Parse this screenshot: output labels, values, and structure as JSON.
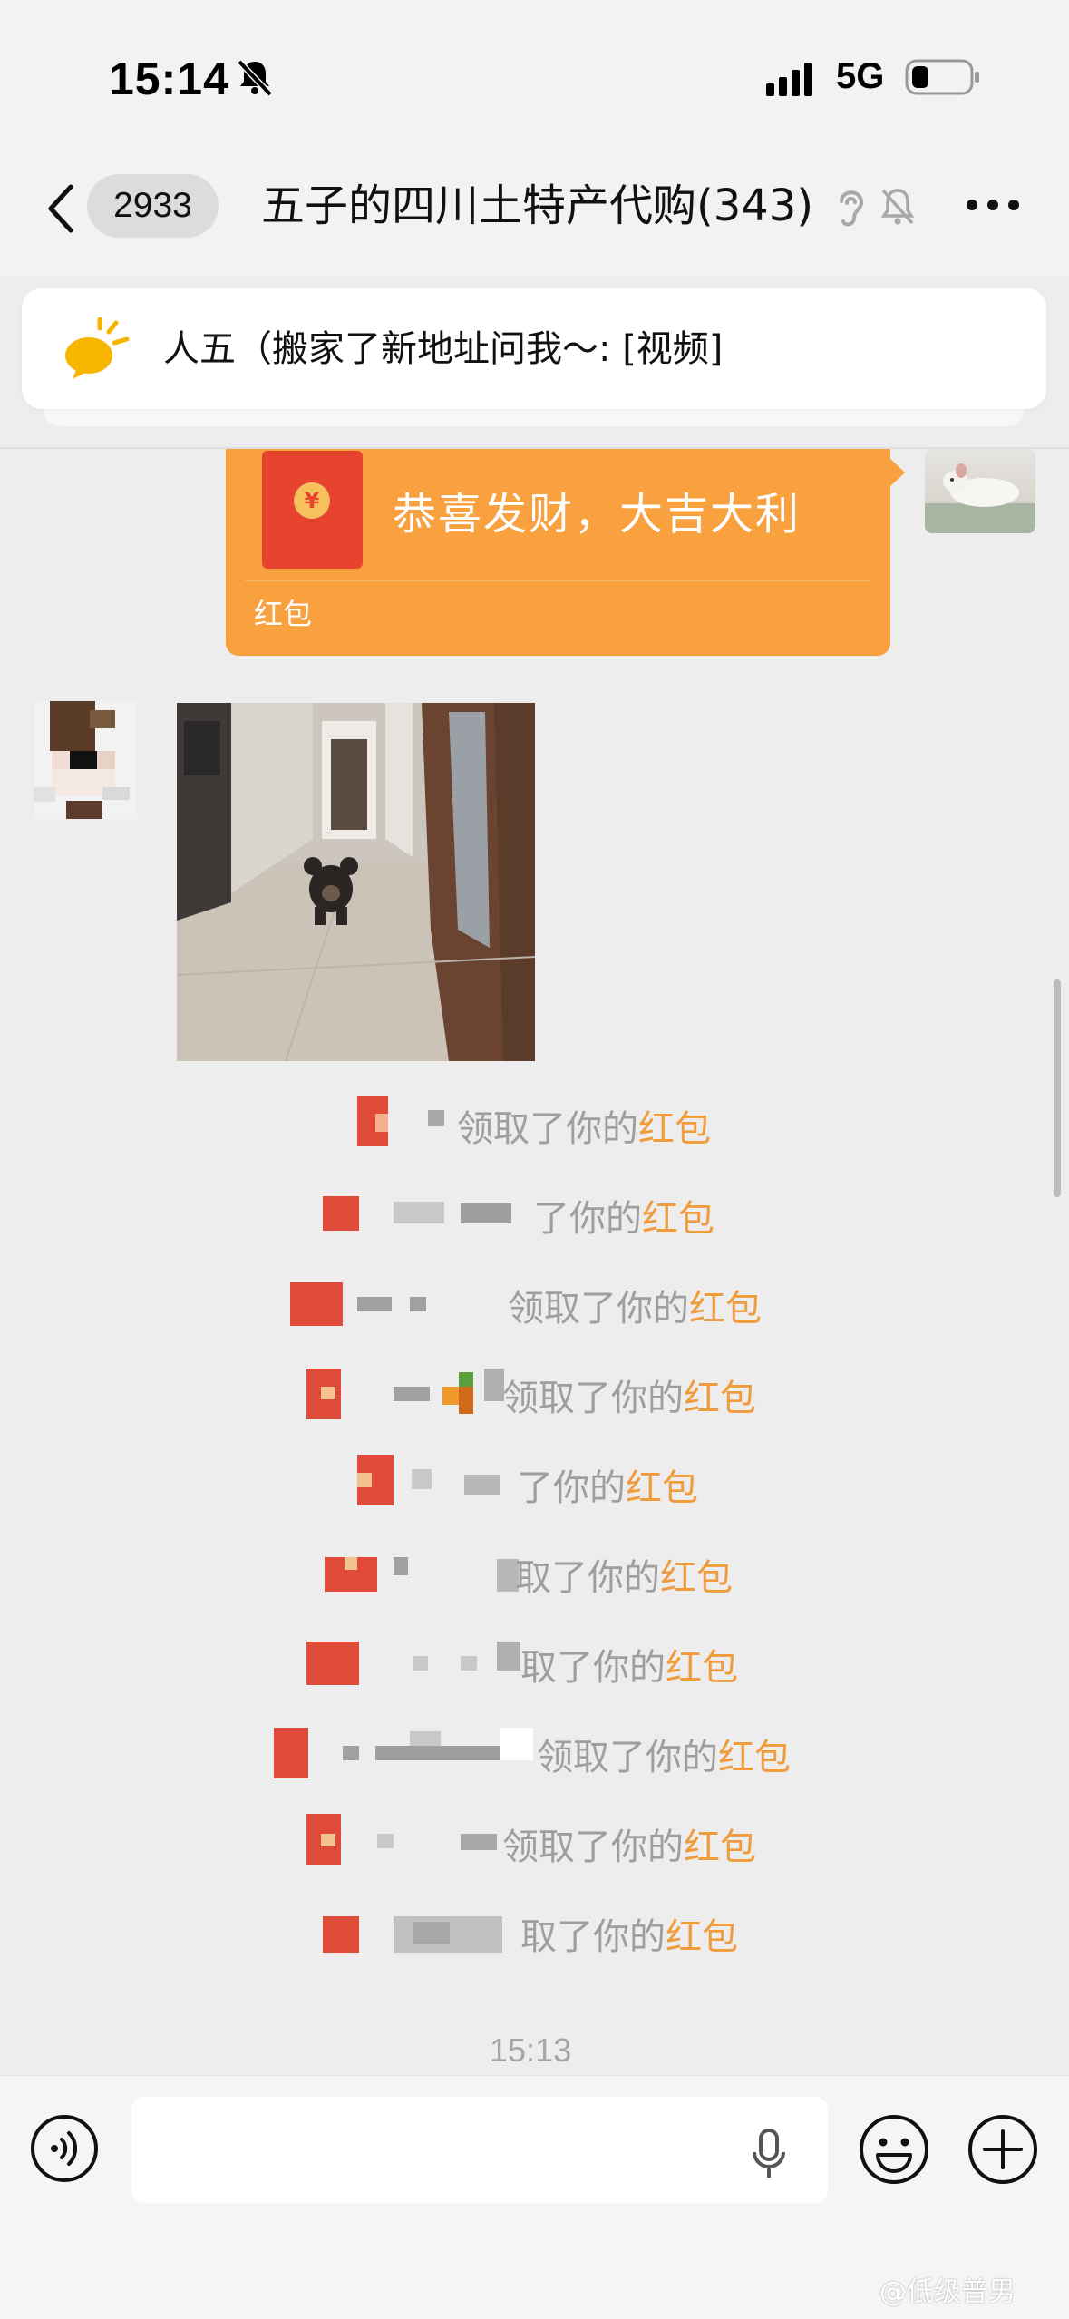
{
  "status_bar": {
    "time": "15:14",
    "network": "5G"
  },
  "nav": {
    "unread_count": "2933",
    "title": "五子的四川土特产代购(343)"
  },
  "notice": {
    "text": "人五（搬家了新地址问我～: [视频]"
  },
  "red_packet": {
    "wish": "恭喜发财，大吉大利",
    "label": "红包",
    "coin": "¥"
  },
  "system_messages": [
    {
      "prefix": "领取了你的",
      "link": "红包"
    },
    {
      "prefix": "了你的",
      "link": "红包"
    },
    {
      "prefix": "领取了你的",
      "link": "红包"
    },
    {
      "prefix": "领取了你的",
      "link": "红包"
    },
    {
      "prefix": "了你的",
      "link": "红包"
    },
    {
      "prefix": "取了你的",
      "link": "红包"
    },
    {
      "prefix": "取了你的",
      "link": "红包"
    },
    {
      "prefix": "领取了你的",
      "link": "红包"
    },
    {
      "prefix": "领取了你的",
      "link": "红包"
    },
    {
      "prefix": "取了你的",
      "link": "红包"
    }
  ],
  "timestamp": "15:13",
  "watermark": "@低级普男",
  "colors": {
    "accent": "#f09b3c",
    "packet": "#f9a03f",
    "envelope": "#e8432f"
  },
  "icons": [
    "mute-icon",
    "signal-icon",
    "battery-icon",
    "back-icon",
    "ear-icon",
    "bell-off-icon",
    "more-icon",
    "speaker-icon",
    "voice-icon",
    "mic-icon",
    "emoji-icon",
    "add-icon"
  ]
}
